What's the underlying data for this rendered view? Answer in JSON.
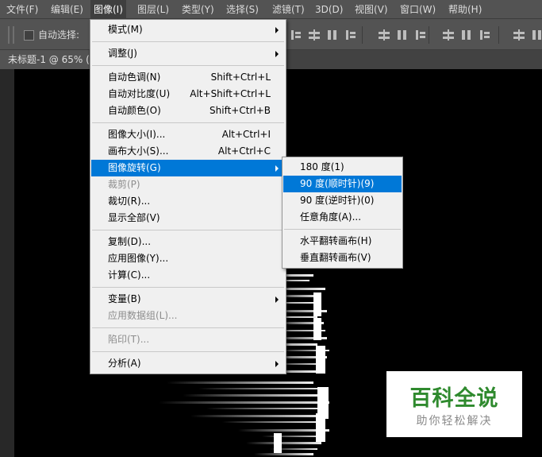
{
  "menubar": {
    "items": [
      "文件(F)",
      "编辑(E)",
      "图像(I)",
      "图层(L)",
      "类型(Y)",
      "选择(S)",
      "滤镜(T)",
      "3D(D)",
      "视图(V)",
      "窗口(W)",
      "帮助(H)"
    ],
    "active_index": 2
  },
  "options": {
    "auto_select_label": "自动选择:",
    "auto_select_checked": false
  },
  "document": {
    "tab_title": "未标题-1 @ 65% (",
    "background_color": "#000000"
  },
  "image_menu": {
    "groups": [
      [
        {
          "label": "模式(M)",
          "submenu": true
        }
      ],
      [
        {
          "label": "调整(J)",
          "submenu": true
        }
      ],
      [
        {
          "label": "自动色调(N)",
          "shortcut": "Shift+Ctrl+L"
        },
        {
          "label": "自动对比度(U)",
          "shortcut": "Alt+Shift+Ctrl+L"
        },
        {
          "label": "自动颜色(O)",
          "shortcut": "Shift+Ctrl+B"
        }
      ],
      [
        {
          "label": "图像大小(I)...",
          "shortcut": "Alt+Ctrl+I"
        },
        {
          "label": "画布大小(S)...",
          "shortcut": "Alt+Ctrl+C"
        },
        {
          "label": "图像旋转(G)",
          "submenu": true,
          "highlighted": true
        },
        {
          "label": "裁剪(P)",
          "disabled": true
        },
        {
          "label": "裁切(R)..."
        },
        {
          "label": "显示全部(V)"
        }
      ],
      [
        {
          "label": "复制(D)..."
        },
        {
          "label": "应用图像(Y)..."
        },
        {
          "label": "计算(C)..."
        }
      ],
      [
        {
          "label": "变量(B)",
          "submenu": true
        },
        {
          "label": "应用数据组(L)...",
          "disabled": true
        }
      ],
      [
        {
          "label": "陷印(T)...",
          "disabled": true
        }
      ],
      [
        {
          "label": "分析(A)",
          "submenu": true
        }
      ]
    ]
  },
  "rotation_submenu": {
    "groups": [
      [
        {
          "label": "180 度(1)"
        },
        {
          "label": "90 度(顺时针)(9)",
          "highlighted": true
        },
        {
          "label": "90 度(逆时针)(0)"
        },
        {
          "label": "任意角度(A)..."
        }
      ],
      [
        {
          "label": "水平翻转画布(H)"
        },
        {
          "label": "垂直翻转画布(V)"
        }
      ]
    ]
  },
  "watermark": {
    "title": "百科全说",
    "subtitle": "助你轻松解决"
  },
  "colors": {
    "menu_highlight": "#0078d7",
    "menu_background": "#f0f0f0",
    "chrome_background": "#535353",
    "watermark_green": "#2f8a2e"
  }
}
